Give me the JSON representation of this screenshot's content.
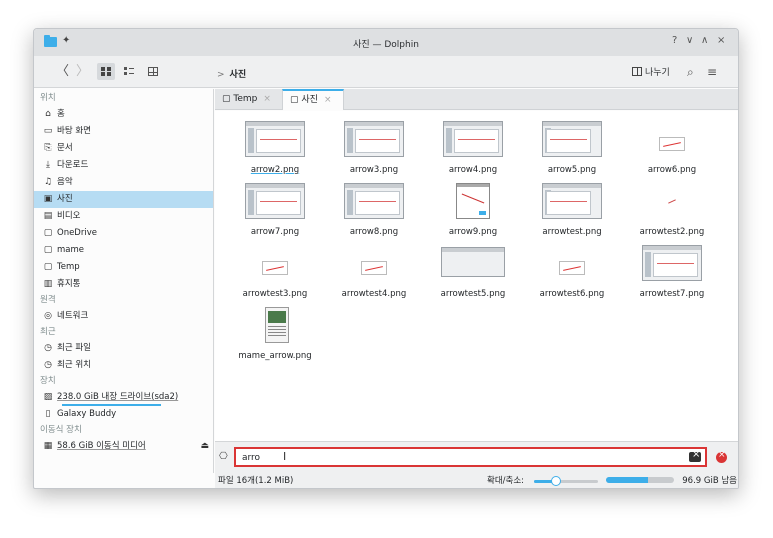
{
  "window": {
    "title": "사진 — Dolphin",
    "controls": [
      "?",
      "∨",
      "∧",
      "×"
    ]
  },
  "toolbar": {
    "back": "〈",
    "forward": "〉",
    "breadcrumb": {
      "separator": ">",
      "current": "사진"
    },
    "split_label": "나누기",
    "search_icon": "⌕",
    "menu_icon": "≡"
  },
  "sidebar": {
    "sections": {
      "places": "위치",
      "remote": "원격",
      "recent": "최근",
      "devices": "장치",
      "removable": "이동식 장치"
    },
    "places": [
      {
        "icon": "home-icon",
        "glyph": "⌂",
        "label": "홈"
      },
      {
        "icon": "desktop-icon",
        "glyph": "▭",
        "label": "바탕 화면"
      },
      {
        "icon": "documents-icon",
        "glyph": "⎘",
        "label": "문서"
      },
      {
        "icon": "downloads-icon",
        "glyph": "⤓",
        "label": "다운로드"
      },
      {
        "icon": "music-icon",
        "glyph": "♫",
        "label": "음악"
      },
      {
        "icon": "pictures-icon",
        "glyph": "▣",
        "label": "사진",
        "selected": true
      },
      {
        "icon": "videos-icon",
        "glyph": "▤",
        "label": "비디오"
      },
      {
        "icon": "folder-icon",
        "glyph": "▢",
        "label": "OneDrive"
      },
      {
        "icon": "folder-icon",
        "glyph": "▢",
        "label": "mame"
      },
      {
        "icon": "folder-icon",
        "glyph": "▢",
        "label": "Temp"
      },
      {
        "icon": "trash-icon",
        "glyph": "▥",
        "label": "휴지통"
      }
    ],
    "remote": [
      {
        "icon": "network-icon",
        "glyph": "◎",
        "label": "네트워크"
      }
    ],
    "recent": [
      {
        "icon": "recent-files-icon",
        "glyph": "◷",
        "label": "최근 파일"
      },
      {
        "icon": "recent-locations-icon",
        "glyph": "◷",
        "label": "최근 위치"
      }
    ],
    "devices": [
      {
        "icon": "drive-icon",
        "glyph": "▨",
        "label": "238.0 GiB 내장 드라이브(sda2)",
        "usage": 0.55
      },
      {
        "icon": "phone-icon",
        "glyph": "▯",
        "label": "Galaxy Buddy"
      }
    ],
    "removable": [
      {
        "icon": "usb-icon",
        "glyph": "▦",
        "label": "58.6 GiB 이동식 미디어",
        "eject": "⏏"
      }
    ]
  },
  "tabs": [
    {
      "label": "Temp",
      "close": "×",
      "active": false
    },
    {
      "label": "사진",
      "close": "×",
      "active": true
    }
  ],
  "files": [
    {
      "name": "arrow2.png",
      "thumb": "shot",
      "selected": true
    },
    {
      "name": "arrow3.png",
      "thumb": "shot"
    },
    {
      "name": "arrow4.png",
      "thumb": "shot"
    },
    {
      "name": "arrow5.png",
      "thumb": "shot-left"
    },
    {
      "name": "arrow6.png",
      "thumb": "small"
    },
    {
      "name": "arrow7.png",
      "thumb": "shot"
    },
    {
      "name": "arrow8.png",
      "thumb": "shot"
    },
    {
      "name": "arrow9.png",
      "thumb": "dialog"
    },
    {
      "name": "arrowtest.png",
      "thumb": "shot-left"
    },
    {
      "name": "arrowtest2.png",
      "thumb": "tiny"
    },
    {
      "name": "arrowtest3.png",
      "thumb": "small"
    },
    {
      "name": "arrowtest4.png",
      "thumb": "small"
    },
    {
      "name": "arrowtest5.png",
      "thumb": "wide"
    },
    {
      "name": "arrowtest6.png",
      "thumb": "small"
    },
    {
      "name": "arrowtest7.png",
      "thumb": "shot"
    },
    {
      "name": "mame_arrow.png",
      "thumb": "term"
    }
  ],
  "filter": {
    "label_icon": "filter-icon",
    "glyph": "⎔",
    "value": "arro",
    "placeholder": ""
  },
  "status": {
    "count": "파일 16개(1.2 MiB)",
    "zoom_label": "확대/축소:",
    "zoom_level": 0.35,
    "free_space": "96.9 GiB 남음",
    "used_fraction": 0.62
  }
}
